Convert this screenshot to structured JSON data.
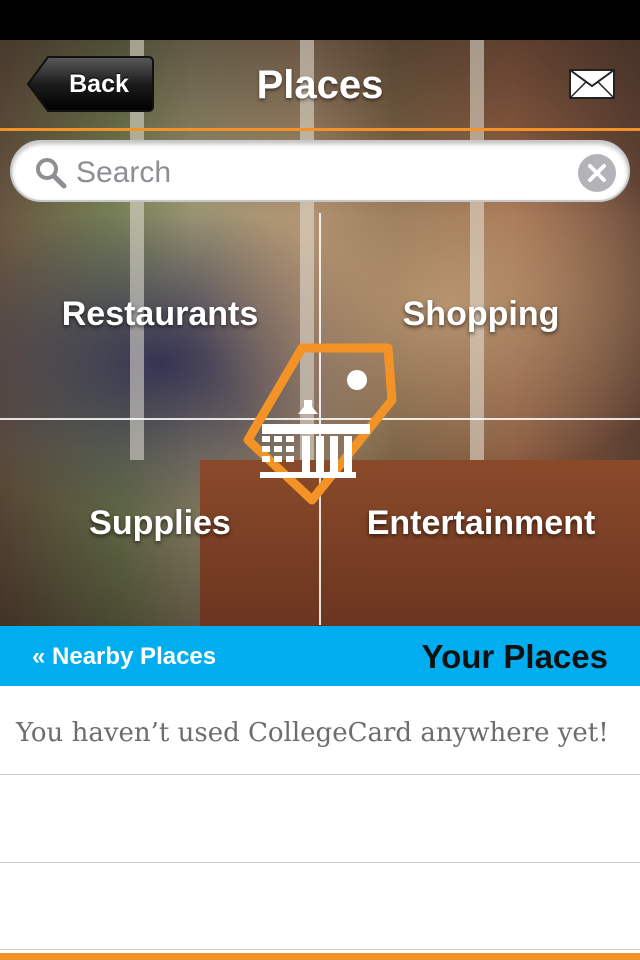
{
  "header": {
    "back_label": "Back",
    "title": "Places"
  },
  "search": {
    "placeholder": "Search",
    "value": ""
  },
  "categories": [
    {
      "label": "Restaurants"
    },
    {
      "label": "Shopping"
    },
    {
      "label": "Supplies"
    },
    {
      "label": "Entertainment"
    }
  ],
  "tabs": {
    "nearby_label": "« Nearby Places",
    "your_label": "Your Places"
  },
  "list": {
    "empty_message": "You haven’t used CollegeCard anywhere yet!"
  },
  "colors": {
    "accent_orange": "#f39325",
    "tab_blue": "#00aeef"
  },
  "icons": [
    "back-arrow-icon",
    "mail-icon",
    "search-icon",
    "clear-icon",
    "collegecard-logo-icon"
  ]
}
